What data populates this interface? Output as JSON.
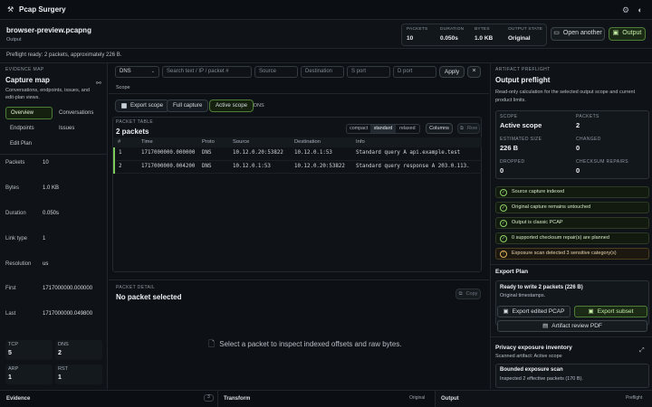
{
  "app": {
    "title": "Pcap Surgery"
  },
  "file": {
    "name": "browser-preview.pcapng",
    "sub": "Output"
  },
  "stats": [
    {
      "k": "PACKETS",
      "v": "10"
    },
    {
      "k": "DURATION",
      "v": "0.050s"
    },
    {
      "k": "BYTES",
      "v": "1.0 KB"
    },
    {
      "k": "OUTPUT STATE",
      "v": "Original"
    }
  ],
  "header_buttons": {
    "open_another": "Open another",
    "output": "Output"
  },
  "preflight_msg": "Preflight ready: 2 packets, approximately 226 B.",
  "left": {
    "section": "EVIDENCE MAP",
    "title": "Capture map",
    "desc": "Conversations, endpoints, issues, and edit-plan views.",
    "tabs": [
      "Overview",
      "Conversations",
      "Endpoints",
      "Issues",
      "Edit Plan"
    ],
    "props": [
      {
        "k": "Packets",
        "v": "10"
      },
      {
        "k": "Bytes",
        "v": "1.0 KB"
      },
      {
        "k": "Duration",
        "v": "0.050s"
      },
      {
        "k": "Link type",
        "v": "1"
      },
      {
        "k": "Resolution",
        "v": "us"
      },
      {
        "k": "First",
        "v": "1717000000.000000"
      },
      {
        "k": "Last",
        "v": "1717000000.049800"
      }
    ],
    "protocols": [
      {
        "k": "TCP",
        "v": "5"
      },
      {
        "k": "DNS",
        "v": "2"
      },
      {
        "k": "ARP",
        "v": "1"
      },
      {
        "k": "RST",
        "v": "1"
      }
    ]
  },
  "filter": {
    "protocol": "DNS",
    "search_ph": "Search text / IP / packet #",
    "source_ph": "Source",
    "dest_ph": "Destination",
    "sport_ph": "S port",
    "dport_ph": "D port",
    "apply": "Apply",
    "clear": "×"
  },
  "scope": {
    "label": "Scope",
    "export_scope": "Export scope",
    "full_capture": "Full capture",
    "active_scope": "Active scope",
    "tag": "DNS"
  },
  "packet_table": {
    "section": "PACKET TABLE",
    "count": "2 packets",
    "density": [
      "compact",
      "standard",
      "relaxed"
    ],
    "columns_btn": "Columns",
    "row_btn": "Row",
    "headers": [
      "#",
      "Time",
      "Proto",
      "Source",
      "Destination",
      "Info"
    ],
    "rows": [
      [
        "1",
        "1717000000.000000",
        "DNS",
        "10.12.0.20:53822",
        "10.12.0.1:53",
        "Standard query A api.example.test"
      ],
      [
        "2",
        "1717000000.004200",
        "DNS",
        "10.12.0.1:53",
        "10.12.0.20:53822",
        "Standard query response A 203.0.113."
      ]
    ]
  },
  "packet_detail": {
    "section": "PACKET DETAIL",
    "title": "No packet selected",
    "copy": "Copy",
    "hint": "Select a packet to inspect indexed offsets and raw bytes."
  },
  "preflight": {
    "section": "ARTIFACT PREFLIGHT",
    "title": "Output preflight",
    "desc": "Read-only calculation for the selected output scope and current product limits.",
    "tiles": [
      {
        "k": "SCOPE",
        "v": "Active scope"
      },
      {
        "k": "PACKETS",
        "v": "2"
      },
      {
        "k": "ESTIMATED SIZE",
        "v": "226 B"
      },
      {
        "k": "CHANGED",
        "v": "0"
      },
      {
        "k": "DROPPED",
        "v": "0"
      },
      {
        "k": "CHECKSUM REPAIRS",
        "v": "0"
      }
    ],
    "checks": [
      "Source capture indexed",
      "Original capture remains untouched",
      "Output is classic PCAP",
      "0 supported checksum repair(s) are planned",
      "Exposure scan detected 3 sensitive category(s)"
    ]
  },
  "export_plan": {
    "title": "Export Plan",
    "ready": "Ready to write 2 packets (226 B)",
    "ready_sub": "Original timestamps.",
    "export_edited": "Export edited PCAP",
    "export_subset": "Export subset",
    "artifact_review": "Artifact review PDF"
  },
  "privacy": {
    "title": "Privacy exposure inventory",
    "sub": "Scanned artifact: Active scope",
    "bounded_title": "Bounded exposure scan",
    "bounded_sub": "Inspected 2 effective packets (170 B)."
  },
  "bottom": {
    "evidence": "Evidence",
    "evidence_count": "3",
    "transform": "Transform",
    "transform_state": "Original",
    "output": "Output",
    "output_state": "Preflight"
  }
}
